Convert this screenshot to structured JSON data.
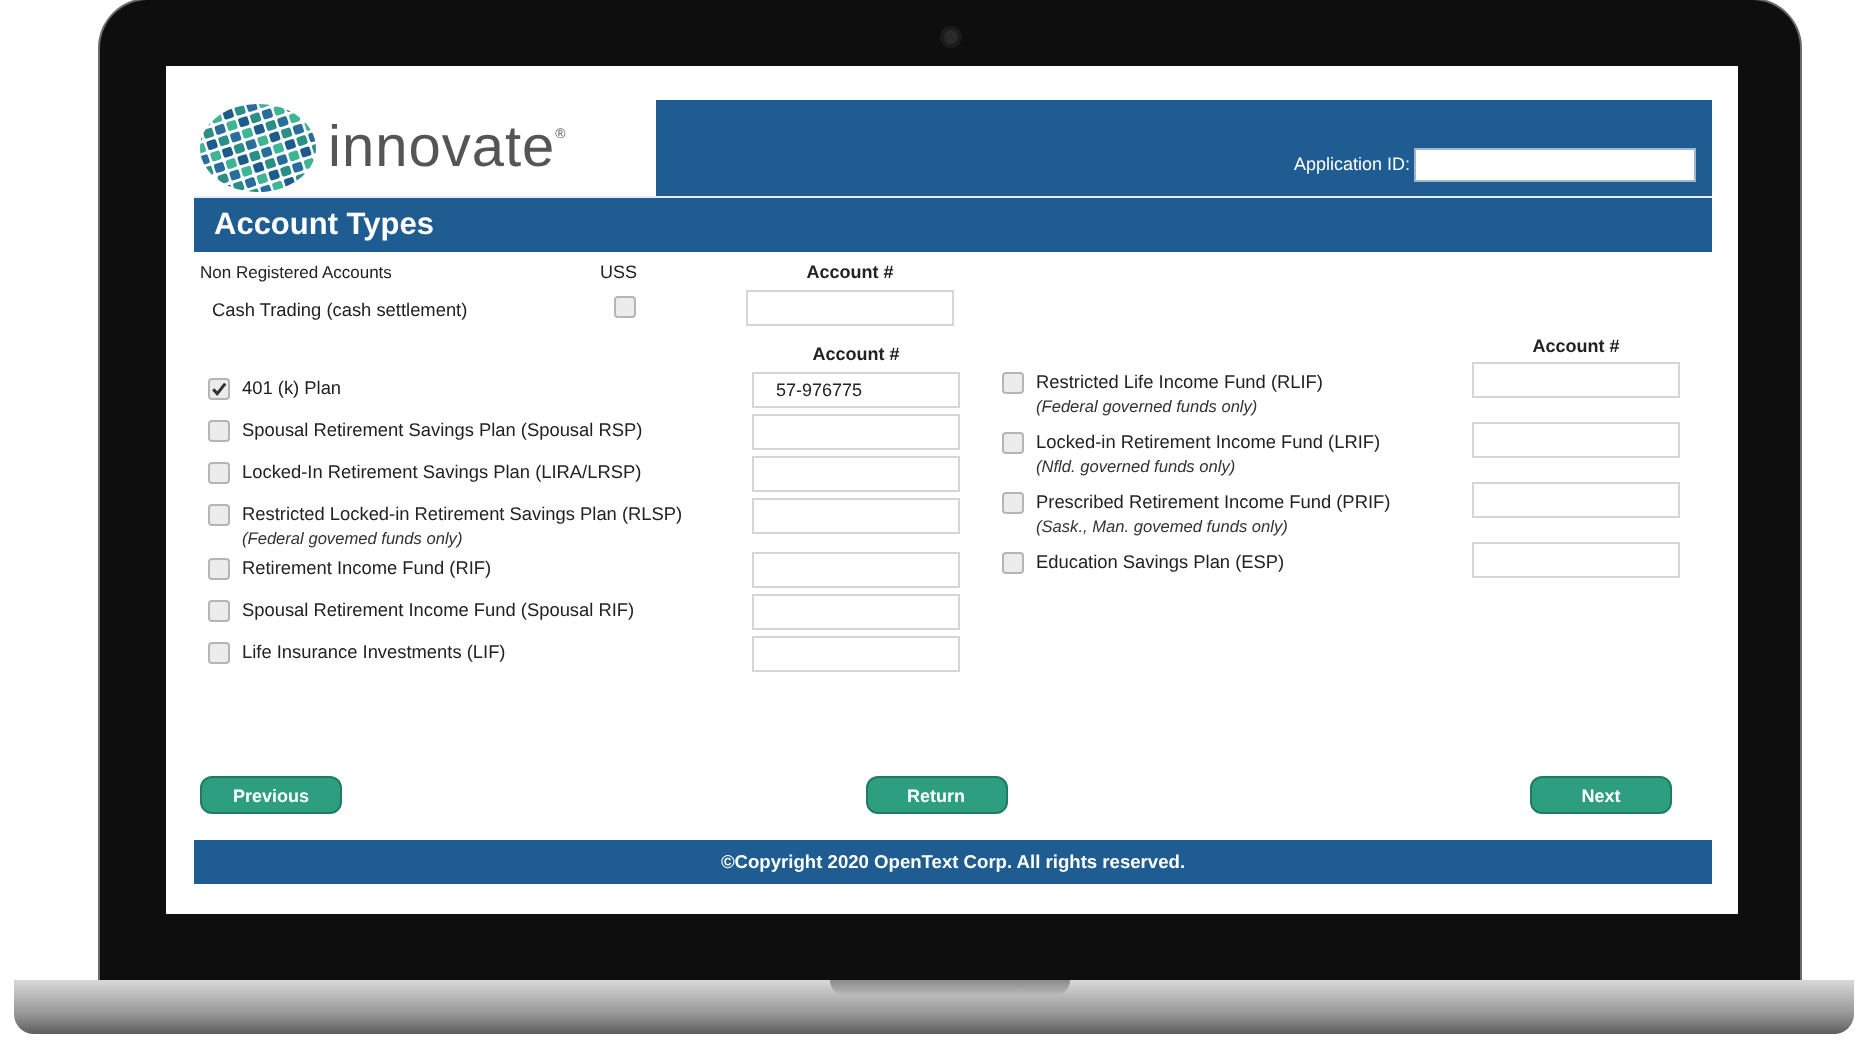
{
  "header": {
    "logo_text": "innovate",
    "logo_mark": "®",
    "application_id": {
      "label": "Application ID:"
    }
  },
  "page_title": "Account Types",
  "non_registered": {
    "heading": "Non Registered Accounts",
    "uss_label": "USS",
    "account_header": "Account #",
    "accounts": [
      {
        "label": "Cash Trading (cash settlement)",
        "checked": false
      }
    ]
  },
  "registered_left": {
    "account_header": "Account #",
    "accounts": [
      {
        "label": "401 (k) Plan",
        "checked": true,
        "account_number": "57-976775"
      },
      {
        "label": "Spousal Retirement Savings Plan (Spousal RSP)",
        "checked": false
      },
      {
        "label": "Locked-In Retirement Savings Plan (LIRA/LRSP)",
        "checked": false
      },
      {
        "label": "Restricted Locked-in Retirement Savings Plan (RLSP)",
        "note": "(Federal govemed funds only)",
        "checked": false
      },
      {
        "label": "Retirement Income Fund (RIF)",
        "checked": false
      },
      {
        "label": "Spousal Retirement Income Fund (Spousal RIF)",
        "checked": false
      },
      {
        "label": "Life Insurance Investments (LIF)",
        "checked": false
      }
    ]
  },
  "registered_right": {
    "account_header": "Account #",
    "accounts": [
      {
        "label": "Restricted Life Income Fund (RLIF)",
        "note": "(Federal governed funds only)",
        "checked": false
      },
      {
        "label": "Locked-in Retirement Income Fund (LRIF)",
        "note": "(Nfld. governed funds only)",
        "checked": false
      },
      {
        "label": "Prescribed Retirement Income Fund (PRIF)",
        "note": "(Sask., Man. govemed funds only)",
        "checked": false
      },
      {
        "label": "Education Savings Plan (ESP)",
        "checked": false
      }
    ]
  },
  "buttons": [
    {
      "label": "Previous"
    },
    {
      "label": "Return"
    },
    {
      "label": "Next"
    }
  ],
  "footer": "©Copyright 2020 OpenText Corp. All rights reserved."
}
